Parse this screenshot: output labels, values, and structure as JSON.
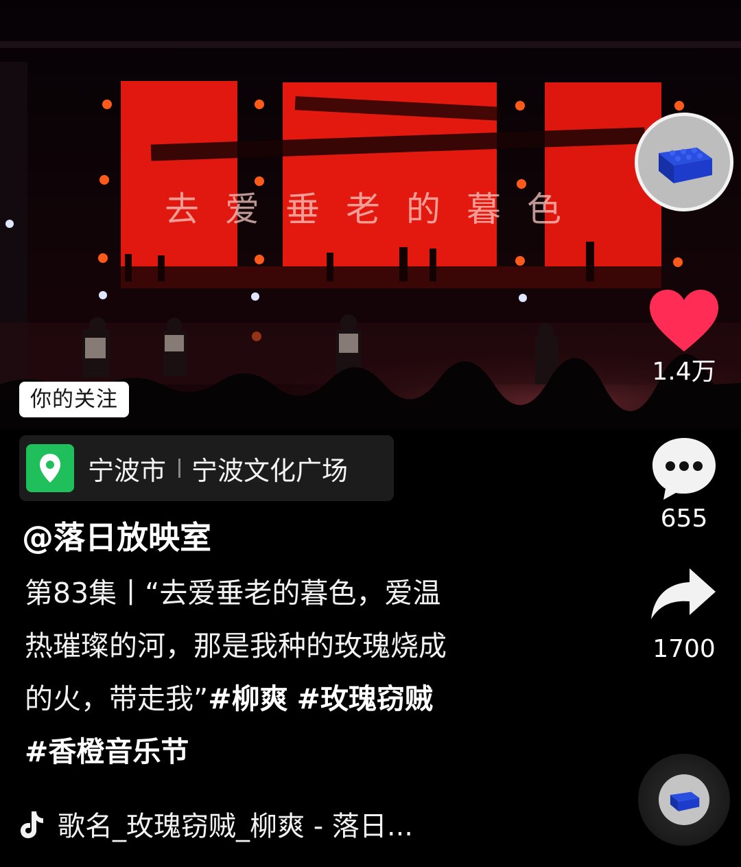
{
  "video": {
    "screen_text": "去爱垂老的暮色",
    "follow_tag": "你的关注"
  },
  "actions": {
    "like_count": "1.4万",
    "comment_count": "655",
    "share_count": "1700"
  },
  "location": {
    "city": "宁波市",
    "place": "宁波文化广场"
  },
  "post": {
    "author": "@落日放映室",
    "caption_lines": [
      "第83集丨“去爱垂老的暮色，爱温",
      "热璀璨的河，那是我种的玫瑰烧成",
      "的火，带走我”"
    ],
    "hashtags": [
      "#柳爽",
      "#玫瑰窃贼",
      "#香橙音乐节"
    ]
  },
  "music": {
    "title": "歌名_玫瑰窃贼_柳爽 - 落日..."
  },
  "colors": {
    "like": "#ff2d55",
    "stage_red": "#e0180f",
    "location_green": "#1fbf5b"
  },
  "icons": [
    "heart-icon",
    "comment-icon",
    "share-icon",
    "location-pin-icon",
    "music-note-icon",
    "music-disc-icon"
  ]
}
